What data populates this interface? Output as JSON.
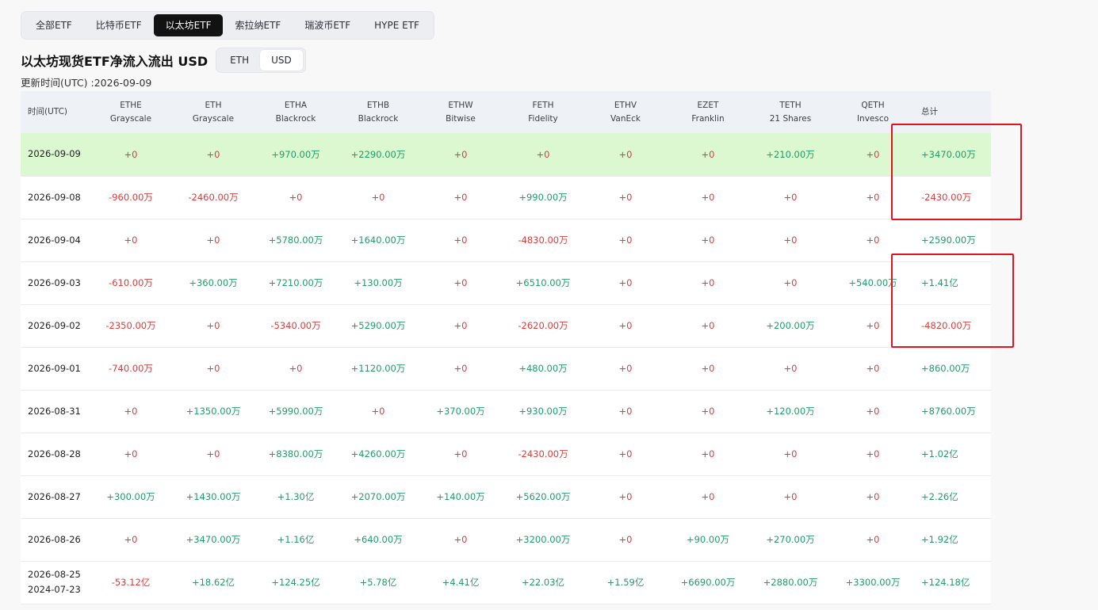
{
  "tabs": [
    {
      "label": "全部ETF",
      "active": false
    },
    {
      "label": "比特币ETF",
      "active": false
    },
    {
      "label": "以太坊ETF",
      "active": true
    },
    {
      "label": "索拉纳ETF",
      "active": false
    },
    {
      "label": "瑞波币ETF",
      "active": false
    },
    {
      "label": "HYPE ETF",
      "active": false
    }
  ],
  "page_title": "以太坊现货ETF净流入流出 USD",
  "unit_toggle": [
    {
      "label": "ETH",
      "active": false
    },
    {
      "label": "USD",
      "active": true
    }
  ],
  "update_time": "更新时间(UTC) :2026-09-09",
  "table": {
    "date_header": "时间(UTC)",
    "total_header": "总计",
    "columns": [
      {
        "ticker": "ETHE",
        "issuer": "Grayscale"
      },
      {
        "ticker": "ETH",
        "issuer": "Grayscale"
      },
      {
        "ticker": "ETHA",
        "issuer": "Blackrock"
      },
      {
        "ticker": "ETHB",
        "issuer": "Blackrock"
      },
      {
        "ticker": "ETHW",
        "issuer": "Bitwise"
      },
      {
        "ticker": "FETH",
        "issuer": "Fidelity"
      },
      {
        "ticker": "ETHV",
        "issuer": "VanEck"
      },
      {
        "ticker": "EZET",
        "issuer": "Franklin"
      },
      {
        "ticker": "TETH",
        "issuer": "21 Shares"
      },
      {
        "ticker": "QETH",
        "issuer": "Invesco"
      }
    ],
    "rows": [
      {
        "date": "2026-09-09",
        "highlight": true,
        "values": [
          "+0",
          "+0",
          "+970.00万",
          "+2290.00万",
          "+0",
          "+0",
          "+0",
          "+0",
          "+210.00万",
          "+0"
        ],
        "total": "+3470.00万"
      },
      {
        "date": "2026-09-08",
        "values": [
          "-960.00万",
          "-2460.00万",
          "+0",
          "+0",
          "+0",
          "+990.00万",
          "+0",
          "+0",
          "+0",
          "+0"
        ],
        "total": "-2430.00万"
      },
      {
        "date": "2026-09-04",
        "values": [
          "+0",
          "+0",
          "+5780.00万",
          "+1640.00万",
          "+0",
          "-4830.00万",
          "+0",
          "+0",
          "+0",
          "+0"
        ],
        "total": "+2590.00万"
      },
      {
        "date": "2026-09-03",
        "values": [
          "-610.00万",
          "+360.00万",
          "+7210.00万",
          "+130.00万",
          "+0",
          "+6510.00万",
          "+0",
          "+0",
          "+0",
          "+540.00万"
        ],
        "total": "+1.41亿"
      },
      {
        "date": "2026-09-02",
        "values": [
          "-2350.00万",
          "+0",
          "-5340.00万",
          "+5290.00万",
          "+0",
          "-2620.00万",
          "+0",
          "+0",
          "+200.00万",
          "+0"
        ],
        "total": "-4820.00万"
      },
      {
        "date": "2026-09-01",
        "values": [
          "-740.00万",
          "+0",
          "+0",
          "+1120.00万",
          "+0",
          "+480.00万",
          "+0",
          "+0",
          "+0",
          "+0"
        ],
        "total": "+860.00万"
      },
      {
        "date": "2026-08-31",
        "values": [
          "+0",
          "+1350.00万",
          "+5990.00万",
          "+0",
          "+370.00万",
          "+930.00万",
          "+0",
          "+0",
          "+120.00万",
          "+0"
        ],
        "total": "+8760.00万"
      },
      {
        "date": "2026-08-28",
        "values": [
          "+0",
          "+0",
          "+8380.00万",
          "+4260.00万",
          "+0",
          "-2430.00万",
          "+0",
          "+0",
          "+0",
          "+0"
        ],
        "total": "+1.02亿"
      },
      {
        "date": "2026-08-27",
        "values": [
          "+300.00万",
          "+1430.00万",
          "+1.30亿",
          "+2070.00万",
          "+140.00万",
          "+5620.00万",
          "+0",
          "+0",
          "+0",
          "+0"
        ],
        "total": "+2.26亿"
      },
      {
        "date": "2026-08-26",
        "values": [
          "+0",
          "+3470.00万",
          "+1.16亿",
          "+640.00万",
          "+0",
          "+3200.00万",
          "+0",
          "+90.00万",
          "+270.00万",
          "+0"
        ],
        "total": "+1.92亿"
      },
      {
        "date": "2026-08-25",
        "date2": "2024-07-23",
        "values": [
          "-53.12亿",
          "+18.62亿",
          "+124.25亿",
          "+5.78亿",
          "+4.41亿",
          "+22.03亿",
          "+1.59亿",
          "+6690.00万",
          "+2880.00万",
          "+3300.00万"
        ],
        "total": "+124.18亿"
      }
    ]
  },
  "colors": {
    "positive": "#1e9e6a",
    "negative": "#e03b3b",
    "highlight_row": "#dcf8d0",
    "annotation_box": "#e0141e"
  }
}
